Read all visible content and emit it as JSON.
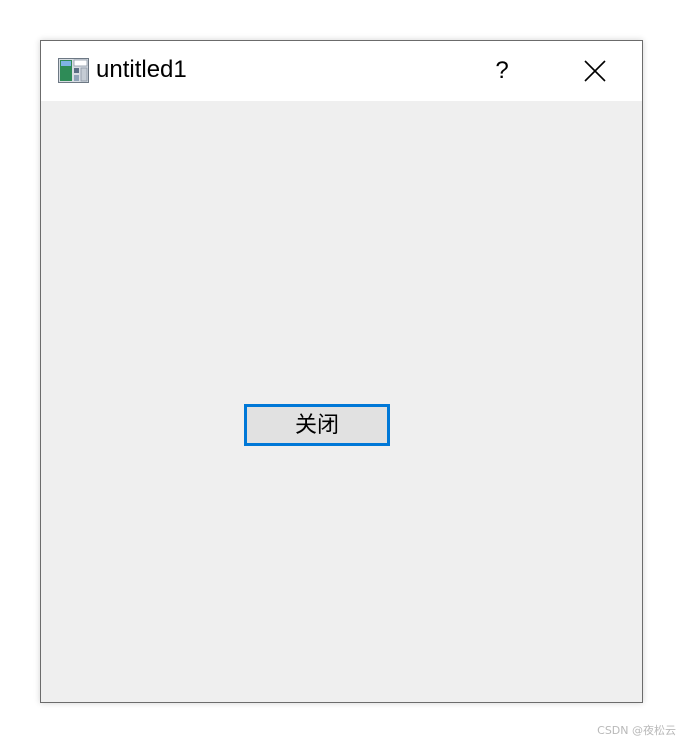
{
  "window": {
    "title": "untitled1",
    "help_label": "?",
    "icon": "qt-designer-form-icon",
    "close_icon": "close-icon"
  },
  "dialog": {
    "close_button_label": "关闭",
    "focus_color": "#0078d7"
  },
  "watermark": {
    "text": "CSDN @夜松云"
  }
}
